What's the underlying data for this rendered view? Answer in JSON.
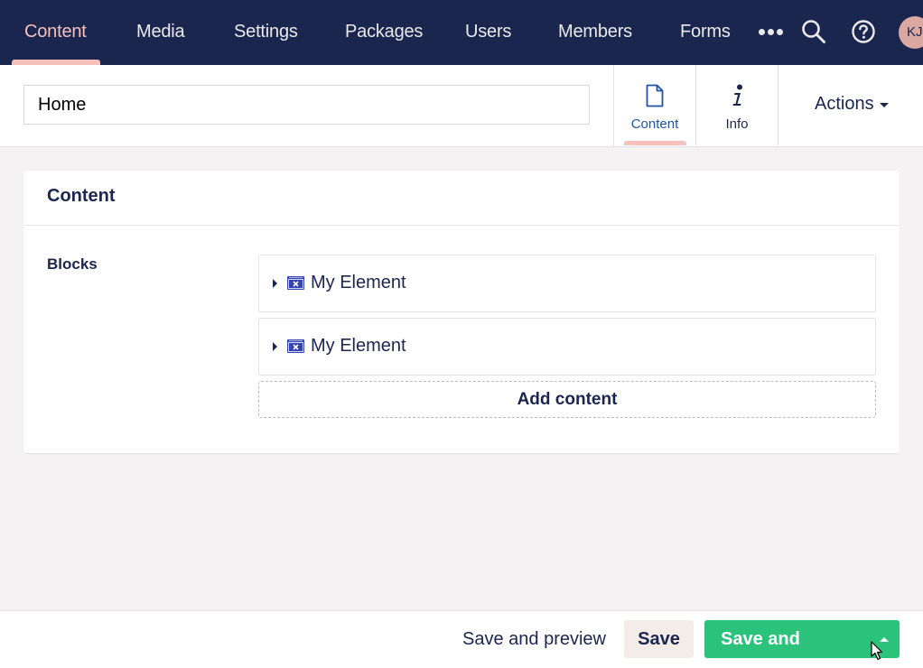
{
  "nav": {
    "items": [
      {
        "label": "Content",
        "active": true
      },
      {
        "label": "Media"
      },
      {
        "label": "Settings"
      },
      {
        "label": "Packages"
      },
      {
        "label": "Users"
      },
      {
        "label": "Members"
      },
      {
        "label": "Forms"
      }
    ],
    "more_icon": "ellipsis-icon",
    "search_icon": "search-icon",
    "help_icon": "help-icon",
    "avatar_initials": "KJ"
  },
  "editor": {
    "name_value": "Home",
    "tabs": [
      {
        "label": "Content",
        "icon": "document-icon",
        "active": true
      },
      {
        "label": "Info",
        "icon": "info-icon"
      }
    ],
    "actions_label": "Actions"
  },
  "panel": {
    "title": "Content",
    "property_label": "Blocks",
    "blocks": [
      {
        "label": "My Element",
        "icon": "element-icon"
      },
      {
        "label": "My Element",
        "icon": "element-icon"
      }
    ],
    "add_label": "Add content"
  },
  "footer": {
    "preview_label": "Save and preview",
    "save_label": "Save",
    "publish_label": "Save and publish"
  },
  "colors": {
    "topbar": "#1b264f",
    "active": "#f5c1bc",
    "publish": "#2bc37c",
    "background": "#f4f2f2"
  }
}
